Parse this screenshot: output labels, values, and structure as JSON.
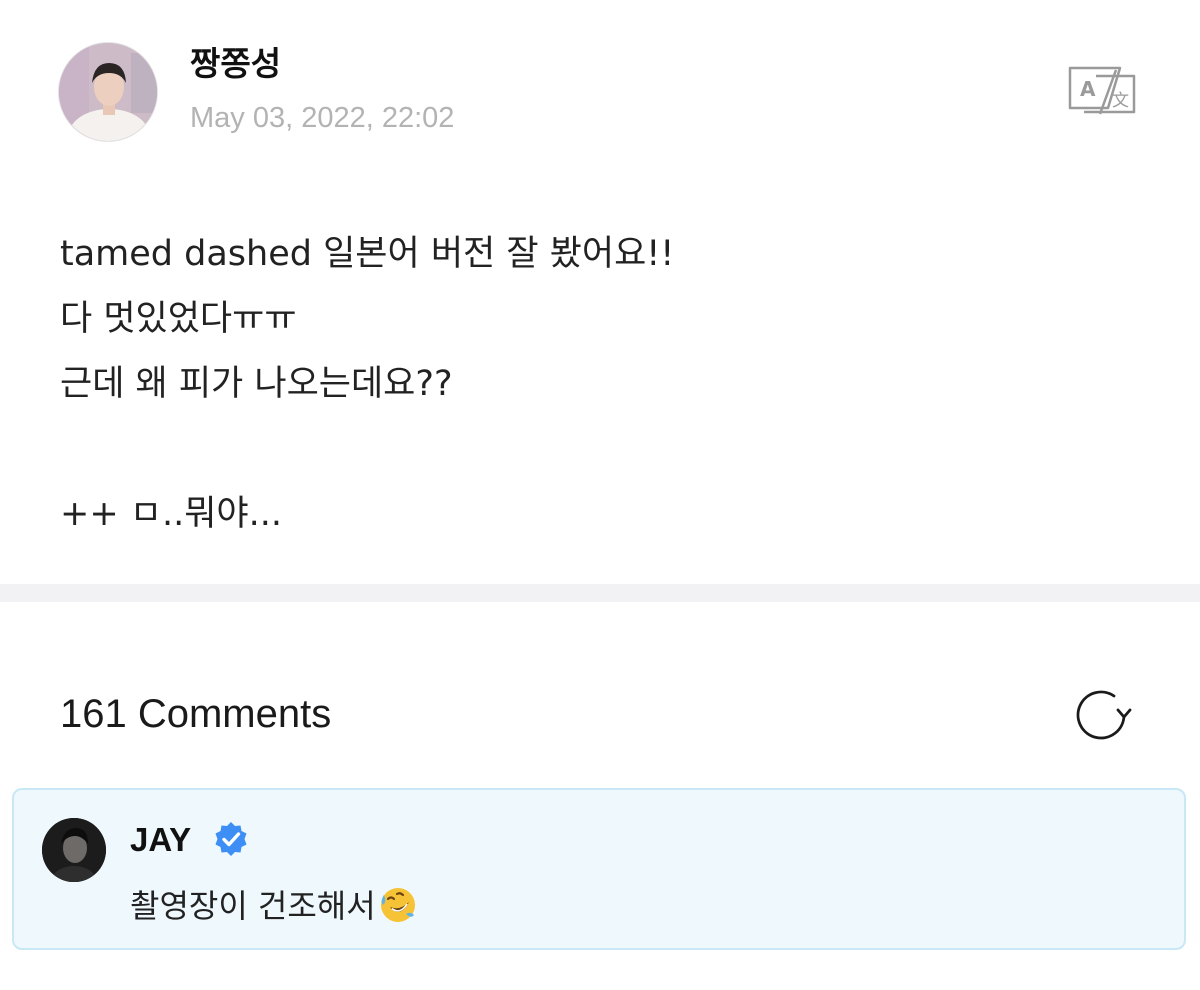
{
  "post": {
    "author": "짱쫑성",
    "date": "May 03, 2022, 22:02",
    "lines": [
      "tamed dashed 일본어 버전 잘 봤어요!!",
      "다 멋있었다ㅠㅠ",
      "근데 왜 피가 나오는데요??",
      "",
      "++ ㅁ..뭐야..."
    ],
    "translate_icon": "translate-icon"
  },
  "comments": {
    "count_label": "161 Comments",
    "refresh_icon": "refresh-icon",
    "items": [
      {
        "author": "JAY",
        "verified": true,
        "text": "촬영장이 건조해서",
        "emoji": "rolling-on-the-floor-laughing-emoji"
      }
    ]
  },
  "colors": {
    "date": "#b3b3b3",
    "divider": "#f2f2f4",
    "comment_bg": "#eef8fd",
    "comment_border": "#c9e8f5",
    "verified": "#3d8ff5"
  }
}
